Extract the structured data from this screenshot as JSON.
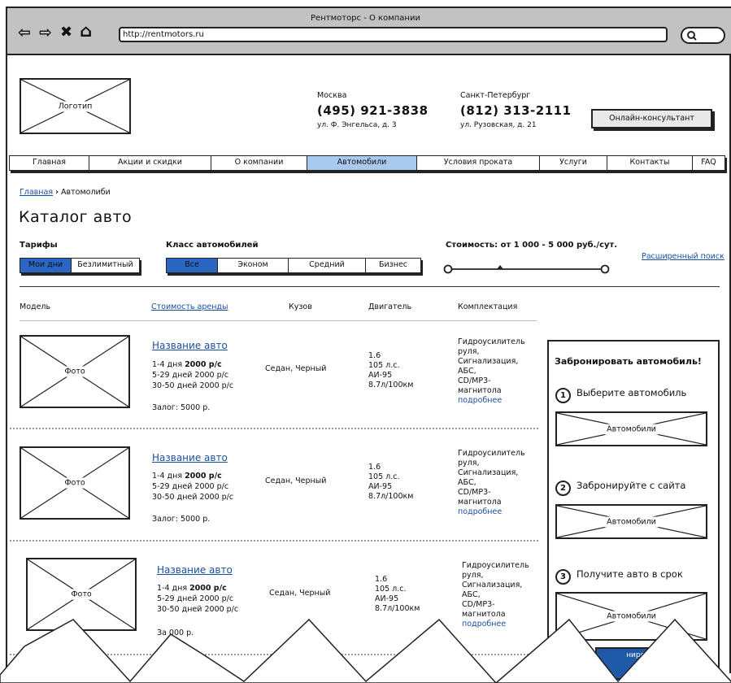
{
  "browser": {
    "title": "Рентмоторс - О компании",
    "url": "http://rentmotors.ru"
  },
  "header": {
    "logo_label": "Логотип",
    "cities": [
      {
        "name": "Москва",
        "phone": "(495) 921-3838",
        "address": "ул. Ф. Энгельса, д. 3"
      },
      {
        "name": "Санкт-Петербург",
        "phone": "(812) 313-2111",
        "address": "ул. Рузовская, д. 21"
      }
    ],
    "consultant_button": "Онлайн-консультант"
  },
  "menu": [
    "Главная",
    "Акции и скидки",
    "О компании",
    "Автомобили",
    "Условия проката",
    "Услуги",
    "Контакты",
    "FAQ"
  ],
  "menu_active": "Автомобили",
  "breadcrumb": {
    "home": "Главная",
    "separator": "›",
    "current": "Автомолиби"
  },
  "page_title": "Каталог авто",
  "filters": {
    "tariffs_label": "Тарифы",
    "tariffs": [
      "Мои дни",
      "Безлимитный"
    ],
    "tariffs_selected": "Мои дни",
    "class_label": "Класс автомобилей",
    "classes": [
      "Все",
      "Эконом",
      "Средний",
      "Бизнес"
    ],
    "class_selected": "Все",
    "price_label": "Стоимость: от 1 000 - 5 000 руб./сут.",
    "advanced_search": "Расширенный поиск"
  },
  "table_headers": {
    "model": "Модель",
    "price": "Стоимость аренды",
    "body": "Кузов",
    "engine": "Двигатель",
    "equipment": "Комплектация"
  },
  "cars": [
    {
      "photo": "Фото",
      "name": "Название авто",
      "rate1_prefix": "1-4 дня",
      "rate1_value": "2000 р/с",
      "rate2": "5-29 дней 2000 р/с",
      "rate3": "30-50 дней  2000 р/с",
      "deposit": "Залог: 5000 р.",
      "body": "Седан, Черный",
      "engine": [
        "1.6",
        "105 л.с.",
        "АИ-95",
        "8.7л/100км"
      ],
      "equipment": [
        "Гидроусилитель",
        "руля,",
        "Сигнализация,",
        "АБС,",
        "CD/MP3-",
        "магнитола"
      ],
      "more": "подробнее"
    },
    {
      "photo": "Фото",
      "name": "Название авто",
      "rate1_prefix": "1-4 дня",
      "rate1_value": "2000 р/с",
      "rate2": "5-29 дней 2000 р/с",
      "rate3": "30-50 дней  2000 р/с",
      "deposit": "Залог: 5000 р.",
      "body": "Седан, Черный",
      "engine": [
        "1.6",
        "105 л.с.",
        "АИ-95",
        "8.7л/100км"
      ],
      "equipment": [
        "Гидроусилитель",
        "руля,",
        "Сигнализация,",
        "АБС,",
        "CD/MP3-",
        "магнитола"
      ],
      "more": "подробнее"
    },
    {
      "photo": "Фото",
      "name": "Название авто",
      "rate1_prefix": "1-4 дня",
      "rate1_value": "2000 р/с",
      "rate2": "5-29 дней 2000 р/с",
      "rate3": "30-50 дней  2000 р/с",
      "deposit": "За  000 р.",
      "body": "Седан, Черный",
      "engine": [
        "1.6",
        "105 л.с.",
        "АИ-95",
        "8.7л/100км"
      ],
      "equipment": [
        "Гидроусилитель",
        "руля,",
        "Сигнализация,",
        "АБС,",
        "CD/MP3-",
        "магнитола"
      ],
      "more": "подробнее"
    }
  ],
  "booking": {
    "title": "Забронировать автомобиль!",
    "steps": [
      {
        "num": "1",
        "text": "Выберите автомобиль",
        "image_label": "Автомобили"
      },
      {
        "num": "2",
        "text": "Забронируйте с сайта",
        "image_label": "Автомобили"
      },
      {
        "num": "3",
        "text": "Получите авто в срок",
        "image_label": "Автомобили"
      }
    ],
    "button_partial": "нирова"
  }
}
